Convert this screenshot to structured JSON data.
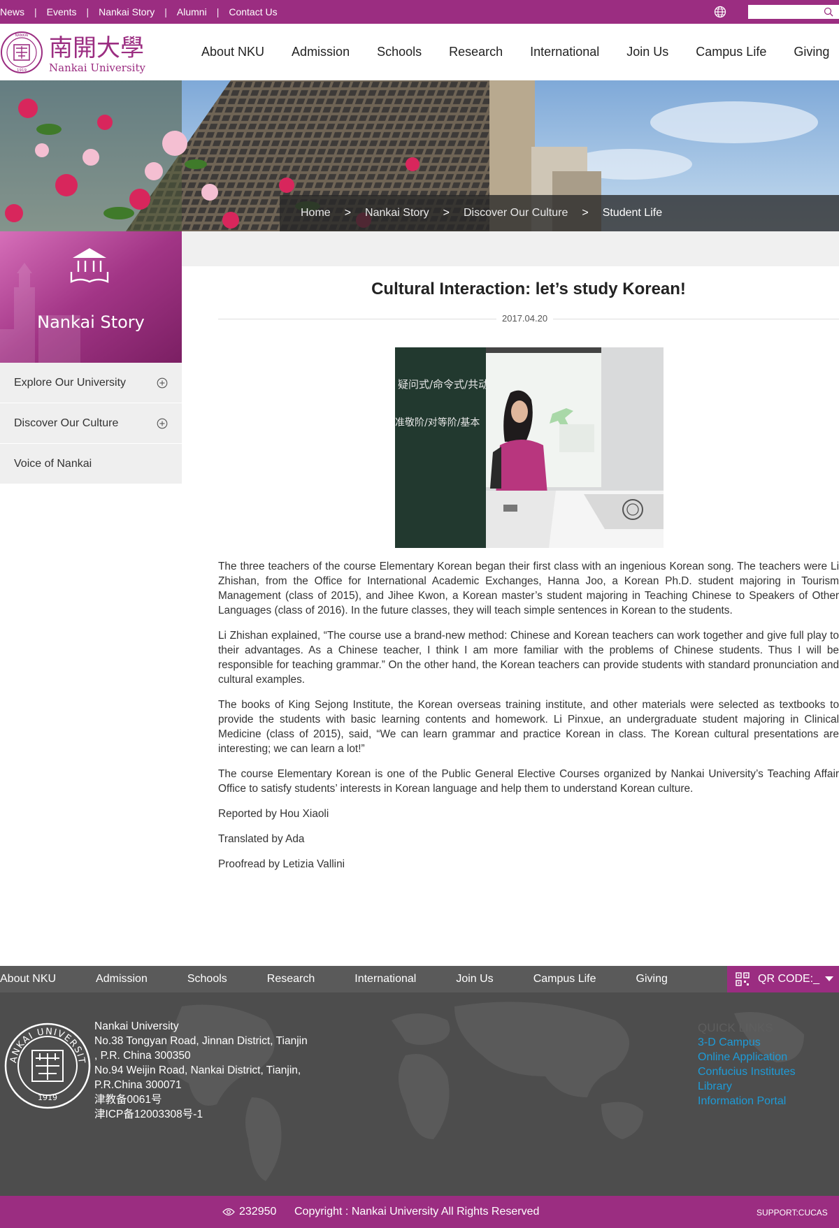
{
  "topbar": {
    "links": [
      "News",
      "Events",
      "Nankai Story",
      "Alumni",
      "Contact Us"
    ],
    "search_placeholder": ""
  },
  "header": {
    "logo_cn": "南開大學",
    "logo_en": "Nankai University",
    "nav": [
      "About NKU",
      "Admission",
      "Schools",
      "Research",
      "International",
      "Join Us",
      "Campus Life",
      "Giving"
    ]
  },
  "breadcrumb": [
    "Home",
    "Nankai Story",
    "Discover Our Culture",
    "Student Life"
  ],
  "sidebar": {
    "title": "Nankai Story",
    "items": [
      {
        "label": "Explore Our University",
        "expandable": true
      },
      {
        "label": "Discover Our Culture",
        "expandable": true
      },
      {
        "label": "Voice of Nankai",
        "expandable": false
      }
    ]
  },
  "article": {
    "title": "Cultural Interaction: let’s study Korean!",
    "date": "2017.04.20",
    "paragraphs": [
      "The three teachers of the course Elementary Korean began their first class with an ingenious Korean song. The teachers were Li Zhishan, from the Office for International Academic Exchanges, Hanna Joo, a Korean Ph.D. student majoring in Tourism Management (class of 2015), and Jihee Kwon, a Korean master’s student majoring in Teaching Chinese to Speakers of Other Languages (class of 2016). In the future classes, they will teach simple sentences in Korean to the students.",
      "Li Zhishan explained, “The course use a brand-new method: Chinese and Korean teachers can work together and give full play to their advantages. As a Chinese teacher, I think I am more familiar with the problems of Chinese students. Thus I will be responsible for teaching grammar.” On the other hand, the Korean teachers can provide students with standard pronunciation and cultural examples.",
      "The books of King Sejong Institute, the Korean overseas training institute, and other materials were selected as textbooks to provide the students with basic learning contents and homework. Li Pinxue, an undergraduate student majoring in Clinical Medicine (class of 2015), said, “We can learn grammar and practice Korean in class. The Korean cultural presentations are interesting; we can learn a lot!”",
      "The course Elementary Korean is one of the Public General Elective Courses organized by Nankai University’s Teaching Affair Office to satisfy students’ interests in Korean language and help them to understand Korean culture.",
      "Reported by Hou Xiaoli",
      "Translated by Ada",
      "Proofread by Letizia Vallini"
    ],
    "photo_board_lines": [
      "疑问式/命令式/共动",
      "准敬阶/对等阶/基本"
    ]
  },
  "footer_nav": {
    "items": [
      "About NKU",
      "Admission",
      "Schools",
      "Research",
      "International",
      "Join Us",
      "Campus Life",
      "Giving"
    ],
    "qr_label": "QR CODE:_"
  },
  "footer": {
    "address_lines": [
      "Nankai University",
      "No.38 Tongyan Road, Jinnan District, Tianjin",
      ", P.R. China 300350",
      "No.94 Weijin Road,  Nankai District, Tianjin,",
      "P.R.China  300071",
      "津教备0061号",
      "津ICP备12003308号-1"
    ],
    "quick_links_heading": "QUICK LINKS",
    "quick_links": [
      "3-D Campus",
      "Online Application",
      "Confucius Institutes",
      "Library",
      "Information Portal"
    ],
    "seal_text": "NANKAI UNIVERSITY",
    "seal_year": "1919"
  },
  "bottombar": {
    "visits": "232950",
    "copyright": "Copyright : Nankai University All Rights Reserved",
    "support": "SUPPORT:CUCAS"
  },
  "colors": {
    "brand": "#9b2d81",
    "footer_bg": "#4d4d4d",
    "link_blue": "#1e9bd7"
  }
}
